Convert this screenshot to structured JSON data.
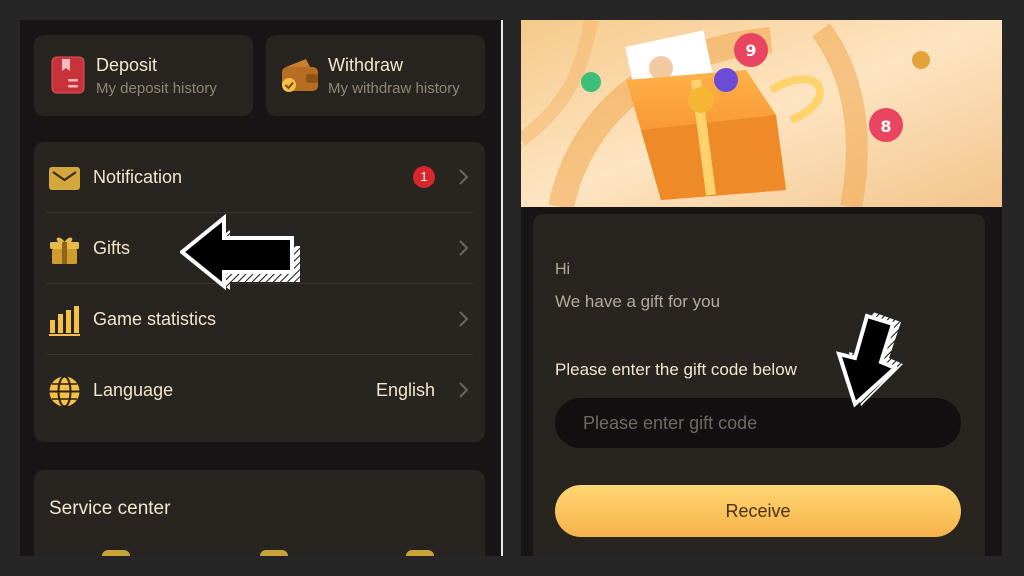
{
  "left": {
    "deposit": {
      "title": "Deposit",
      "subtitle": "My deposit history",
      "icon": "deposit-book-icon"
    },
    "withdraw": {
      "title": "Withdraw",
      "subtitle": "My withdraw history",
      "icon": "wallet-icon"
    },
    "menu": [
      {
        "label": "Notification",
        "icon": "envelope-icon",
        "badge": "1"
      },
      {
        "label": "Gifts",
        "icon": "gift-box-icon"
      },
      {
        "label": "Game statistics",
        "icon": "bar-chart-icon"
      },
      {
        "label": "Language",
        "icon": "globe-icon",
        "value": "English"
      }
    ],
    "service_center": {
      "title": "Service center"
    }
  },
  "right": {
    "greeting": "Hi",
    "message": "We have a gift for you",
    "code_label": "Please enter the gift code below",
    "code_input": {
      "placeholder": "Please enter gift code",
      "value": ""
    },
    "receive_label": "Receive"
  },
  "colors": {
    "panel_bg": "#171516",
    "card_bg": "#28241f",
    "accent_gold": "#f4c04a",
    "text_primary": "#f3e6cf",
    "badge_red": "#d7262c"
  }
}
